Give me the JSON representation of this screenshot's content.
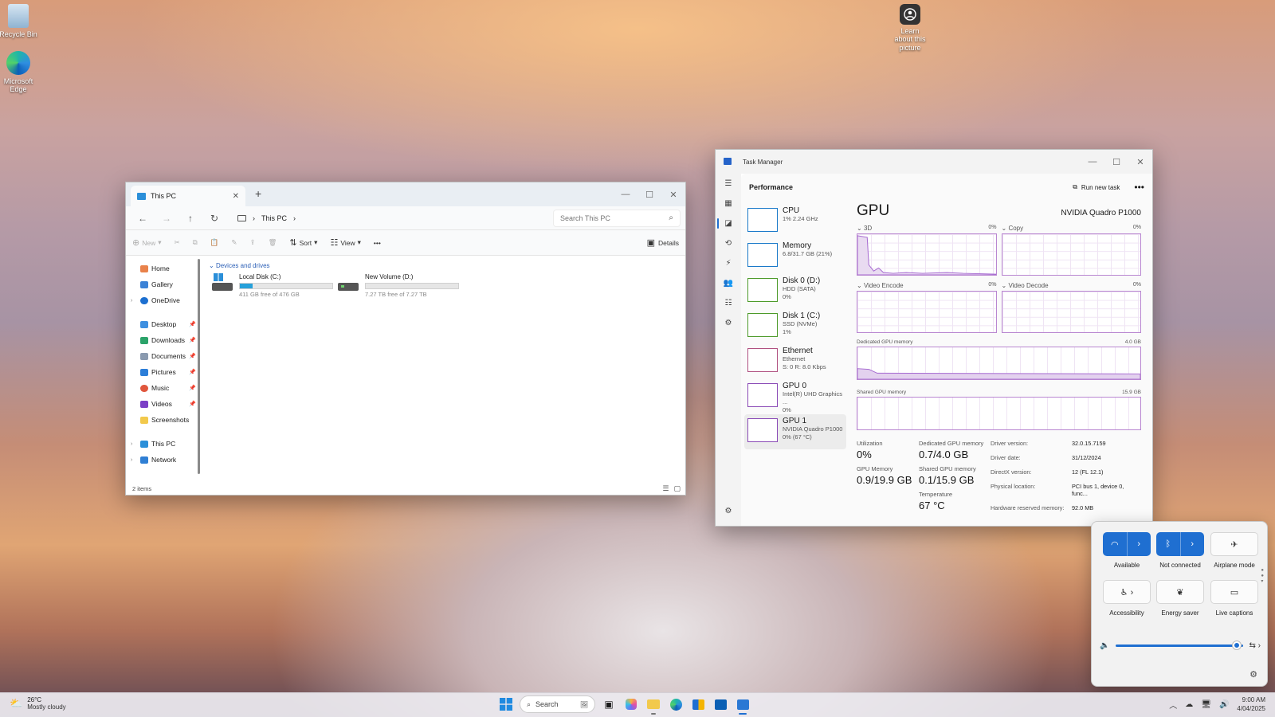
{
  "desktop": {
    "icons": [
      {
        "label": "Recycle Bin"
      },
      {
        "label": "Microsoft Edge"
      },
      {
        "label": "Learn about this picture"
      }
    ]
  },
  "explorer": {
    "tab_title": "This PC",
    "address": "This PC",
    "search_placeholder": "Search This PC",
    "toolbar": {
      "new": "New",
      "sort": "Sort",
      "view": "View",
      "more": "•••",
      "details": "Details"
    },
    "nav": {
      "home": "Home",
      "gallery": "Gallery",
      "onedrive": "OneDrive",
      "desktop": "Desktop",
      "downloads": "Downloads",
      "documents": "Documents",
      "pictures": "Pictures",
      "music": "Music",
      "videos": "Videos",
      "screenshots": "Screenshots",
      "this_pc": "This PC",
      "network": "Network"
    },
    "section": "Devices and drives",
    "drives": [
      {
        "name": "Local Disk (C:)",
        "free": "411 GB free of 476 GB",
        "used_fraction": 0.14
      },
      {
        "name": "New Volume (D:)",
        "free": "7.27 TB free of 7.27 TB",
        "used_fraction": 0.0
      }
    ],
    "status": "2 items"
  },
  "taskmgr": {
    "title": "Task Manager",
    "page": "Performance",
    "run_new_task": "Run new task",
    "more": "•••",
    "items": [
      {
        "name": "CPU",
        "sub1": "1% 2.24 GHz",
        "sub2": "",
        "sub3": "",
        "color": "#1a79c9"
      },
      {
        "name": "Memory",
        "sub1": "6.8/31.7 GB (21%)",
        "sub2": "",
        "sub3": "",
        "color": "#1a79c9"
      },
      {
        "name": "Disk 0 (D:)",
        "sub1": "HDD (SATA)",
        "sub2": "0%",
        "sub3": "",
        "color": "#4d9a2a"
      },
      {
        "name": "Disk 1 (C:)",
        "sub1": "SSD (NVMe)",
        "sub2": "1%",
        "sub3": "",
        "color": "#4d9a2a"
      },
      {
        "name": "Ethernet",
        "sub1": "Ethernet",
        "sub2": "S: 0 R: 8.0 Kbps",
        "sub3": "",
        "color": "#b05080"
      },
      {
        "name": "GPU 0",
        "sub1": "Intel(R) UHD Graphics ...",
        "sub2": "0%",
        "sub3": "",
        "color": "#8a4ab6"
      },
      {
        "name": "GPU 1",
        "sub1": "NVIDIA Quadro P1000",
        "sub2": "0% (67 °C)",
        "sub3": "",
        "color": "#8a4ab6"
      }
    ],
    "gpu": {
      "title": "GPU",
      "model": "NVIDIA Quadro P1000",
      "engines": [
        {
          "name": "3D",
          "pct": "0%"
        },
        {
          "name": "Copy",
          "pct": "0%"
        },
        {
          "name": "Video Encode",
          "pct": "0%"
        },
        {
          "name": "Video Decode",
          "pct": "0%"
        }
      ],
      "dedicated_label": "Dedicated GPU memory",
      "dedicated_max": "4.0 GB",
      "shared_label": "Shared GPU memory",
      "shared_max": "15.9 GB",
      "stats": {
        "utilization_label": "Utilization",
        "utilization": "0%",
        "dedicated_label": "Dedicated GPU memory",
        "dedicated": "0.7/4.0 GB",
        "gpu_memory_label": "GPU Memory",
        "gpu_memory": "0.9/19.9 GB",
        "shared_label": "Shared GPU memory",
        "shared": "0.1/15.9 GB",
        "temp_label": "Temperature",
        "temp": "67 °C"
      },
      "props": [
        {
          "k": "Driver version:",
          "v": "32.0.15.7159"
        },
        {
          "k": "Driver date:",
          "v": "31/12/2024"
        },
        {
          "k": "DirectX version:",
          "v": "12 (FL 12.1)"
        },
        {
          "k": "Physical location:",
          "v": "PCI bus 1, device 0, func..."
        },
        {
          "k": "Hardware reserved memory:",
          "v": "92.0 MB"
        }
      ]
    }
  },
  "quick": {
    "wifi": "Available",
    "bluetooth": "Not connected",
    "airplane": "Airplane mode",
    "accessibility": "Accessibility",
    "energy": "Energy saver",
    "captions": "Live captions",
    "volume_level": 0.96
  },
  "taskbar": {
    "temp": "26°C",
    "weather": "Mostly cloudy",
    "search": "Search",
    "time": "9:00 AM",
    "date": "4/04/2025"
  }
}
